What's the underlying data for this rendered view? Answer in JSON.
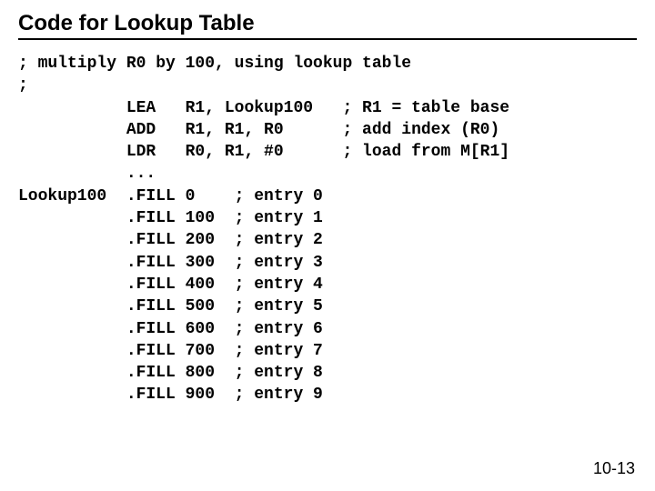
{
  "title": "Code for Lookup Table",
  "lines": {
    "l00": "; multiply R0 by 100, using lookup table",
    "l01": ";",
    "l02": "           LEA   R1, Lookup100   ; R1 = table base",
    "l03": "           ADD   R1, R1, R0      ; add index (R0)",
    "l04": "           LDR   R0, R1, #0      ; load from M[R1]",
    "l05": "           ...",
    "l06": "Lookup100  .FILL 0    ; entry 0",
    "l07": "           .FILL 100  ; entry 1",
    "l08": "           .FILL 200  ; entry 2",
    "l09": "           .FILL 300  ; entry 3",
    "l10": "           .FILL 400  ; entry 4",
    "l11": "           .FILL 500  ; entry 5",
    "l12": "           .FILL 600  ; entry 6",
    "l13": "           .FILL 700  ; entry 7",
    "l14": "           .FILL 800  ; entry 8",
    "l15": "           .FILL 900  ; entry 9"
  },
  "page_number": "10-13"
}
